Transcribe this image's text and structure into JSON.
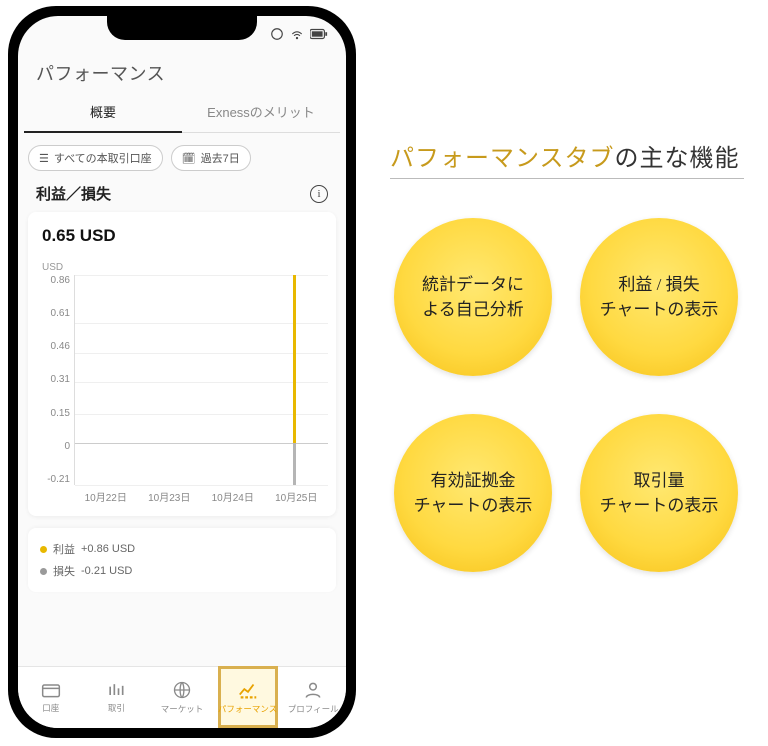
{
  "phone": {
    "page_title": "パフォーマンス",
    "tabs": {
      "overview": "概要",
      "merits": "Exnessのメリット"
    },
    "filters": {
      "accounts_label": "すべての本取引口座",
      "range_label": "過去7日"
    },
    "profit_loss": {
      "title": "利益／損失",
      "value": "0.65 USD"
    },
    "chart_data": {
      "type": "bar",
      "unit": "USD",
      "y_ticks": [
        "0.86",
        "0.61",
        "0.46",
        "0.31",
        "0.15",
        "0",
        "-0.21"
      ],
      "categories": [
        "10月22日",
        "10月23日",
        "10月24日",
        "10月25日"
      ],
      "series": [
        {
          "name": "利益",
          "color": "#e8b800",
          "values": [
            0,
            0,
            0,
            0.86
          ]
        },
        {
          "name": "損失",
          "color": "#9a9a9a",
          "values": [
            0,
            0,
            0,
            -0.21
          ]
        }
      ],
      "ylim": [
        -0.21,
        0.86
      ]
    },
    "legend": {
      "profit_label": "利益",
      "profit_value": "+0.86 USD",
      "loss_label": "損失",
      "loss_value": "-0.21 USD"
    },
    "nav": {
      "accounts": "口座",
      "trade": "取引",
      "market": "マーケット",
      "performance": "パフォーマンス",
      "profile": "プロフィール"
    }
  },
  "right": {
    "headline_accent": "パフォーマンスタブ",
    "headline_rest": "の主な機能",
    "circles": {
      "c1": "統計データに\nよる自己分析",
      "c2": "利益 / 損失\nチャートの表示",
      "c3": "有効証拠金\nチャートの表示",
      "c4": "取引量\nチャートの表示"
    }
  }
}
